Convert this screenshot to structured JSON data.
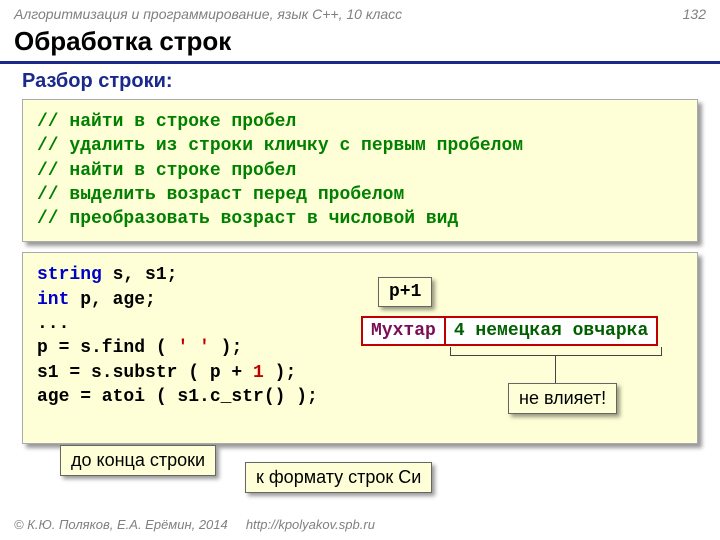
{
  "header": {
    "course": "Алгоритмизация и программирование, язык C++, 10 класс",
    "page_num": "132"
  },
  "title": "Обработка строк",
  "section": "Разбор строки:",
  "comments": {
    "c1": "// найти в строке пробел",
    "c2": "// удалить из строки кличку с первым пробелом",
    "c3": "// найти в строке пробел",
    "c4": "// выделить возраст перед пробелом",
    "c5": "// преобразовать возраст в числовой вид"
  },
  "code": {
    "type_string": "string",
    "decl_s": " s, s1;",
    "type_int": "int",
    "decl_p": " p, age;",
    "dots": "...",
    "line_find_a": "p = s.find ( ",
    "line_find_b": "' '",
    "line_find_c": " );",
    "line_substr_a": "s1 = s.substr ( p + ",
    "line_substr_b": "1",
    "line_substr_c": " );",
    "line_atoi": "age = atoi ( s1.c_str() );"
  },
  "diagram": {
    "pplus1": "p+1",
    "word1": "Мухтар",
    "word2": "4 немецкая овчарка",
    "not_affect": "не влияет!",
    "to_end": "до конца строки",
    "cformat": "к формату строк Си"
  },
  "footer": {
    "copyright": "© К.Ю. Поляков, Е.А. Ерёмин, 2014",
    "url": "http://kpolyakov.spb.ru"
  }
}
